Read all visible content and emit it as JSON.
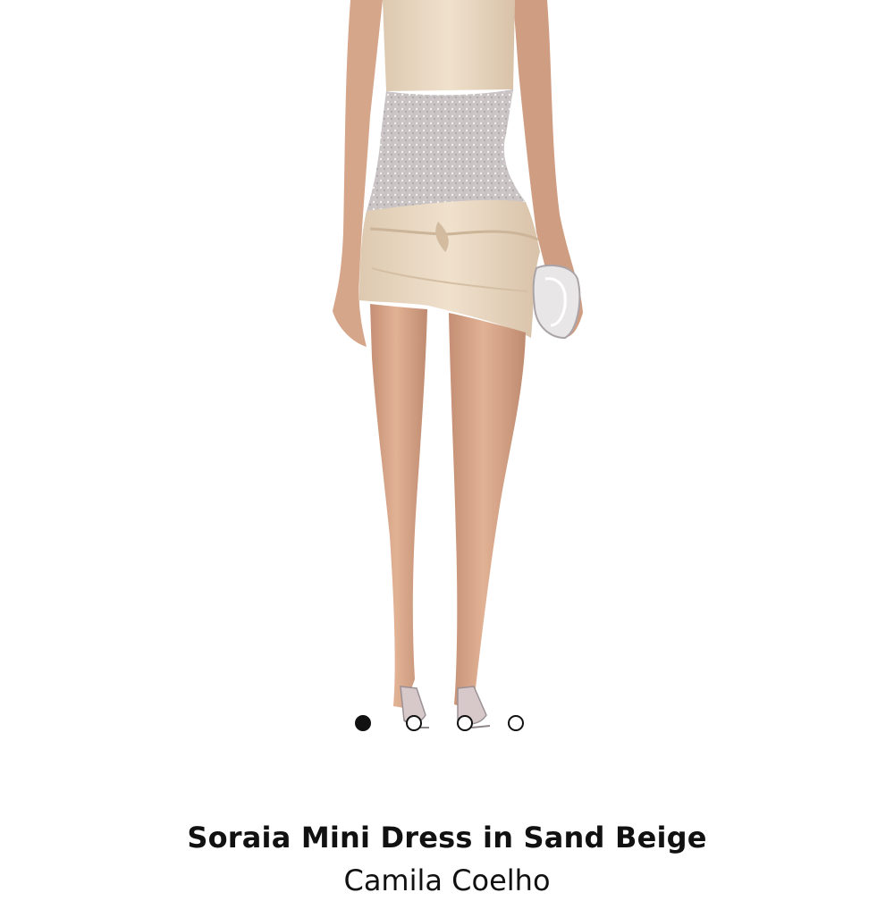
{
  "product": {
    "name": "Soraia Mini Dress in Sand Beige",
    "brand": "Camila Coelho",
    "image_icon": "model-dress-image"
  },
  "gallery": {
    "total_images": 4,
    "current_image": 1
  },
  "colors": {
    "background": "#ffffff",
    "dress": "#ead9c2",
    "skin": "#d9a88c",
    "text": "#111111"
  }
}
